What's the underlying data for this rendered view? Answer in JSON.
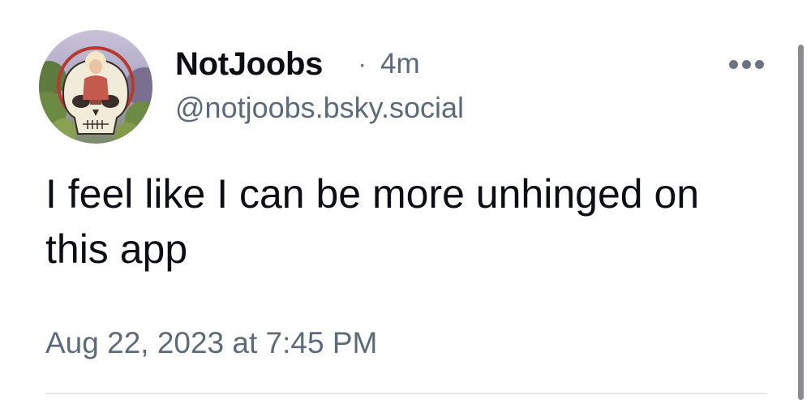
{
  "post": {
    "author": {
      "display_name": "NotJoobs",
      "separator": "·",
      "relative_time": "4m",
      "handle": "@notjoobs.bsky.social",
      "avatar": "avatar-image"
    },
    "more_icon": "ellipsis-icon",
    "text": "I feel like I can be more unhinged on this app",
    "date": "Aug 22, 2023 at 7:45 PM"
  },
  "colors": {
    "primary_text": "#0b0f14",
    "secondary_text": "#5c6b7a",
    "divider": "#e3e7ec"
  }
}
